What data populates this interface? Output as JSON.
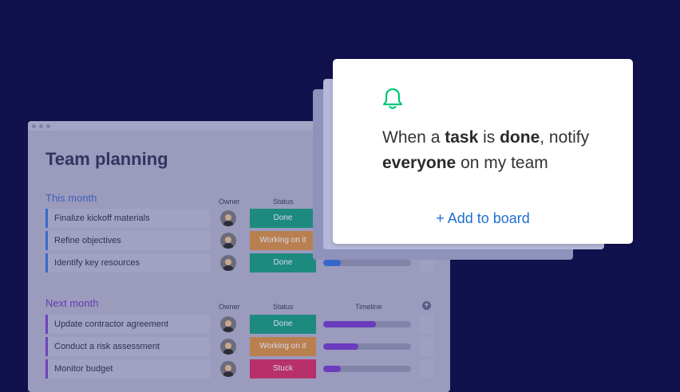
{
  "board": {
    "title": "Team planning",
    "groups": [
      {
        "title": "This month",
        "headers": {
          "owner": "Owner",
          "status": "Status",
          "timeline": ""
        },
        "rows": [
          {
            "name": "Finalize kickoff materials",
            "status": "Done",
            "status_kind": "done",
            "progress": 0.0
          },
          {
            "name": "Refine objectives",
            "status": "Working on it",
            "status_kind": "work",
            "progress": 0.0
          },
          {
            "name": "Identify key resources",
            "status": "Done",
            "status_kind": "done",
            "progress": 0.2
          }
        ]
      },
      {
        "title": "Next month",
        "headers": {
          "owner": "Owner",
          "status": "Status",
          "timeline": "Timeline"
        },
        "rows": [
          {
            "name": "Update contractor agreement",
            "status": "Done",
            "status_kind": "done",
            "progress": 0.6
          },
          {
            "name": "Conduct a risk assessment",
            "status": "Working on it",
            "status_kind": "work",
            "progress": 0.4
          },
          {
            "name": "Monitor budget",
            "status": "Stuck",
            "status_kind": "stuck",
            "progress": 0.2
          }
        ]
      }
    ]
  },
  "card": {
    "icon": "bell-icon",
    "text_parts": [
      "When a ",
      "task",
      " is ",
      "done",
      ", notify ",
      "everyone",
      " on my team"
    ],
    "add_button": "+ Add to board"
  },
  "colors": {
    "background": "#11114e",
    "done": "#1d8a80",
    "working": "#b9804f",
    "stuck": "#b8306a",
    "bell": "#00c875",
    "add_button": "#1f6ed4"
  }
}
